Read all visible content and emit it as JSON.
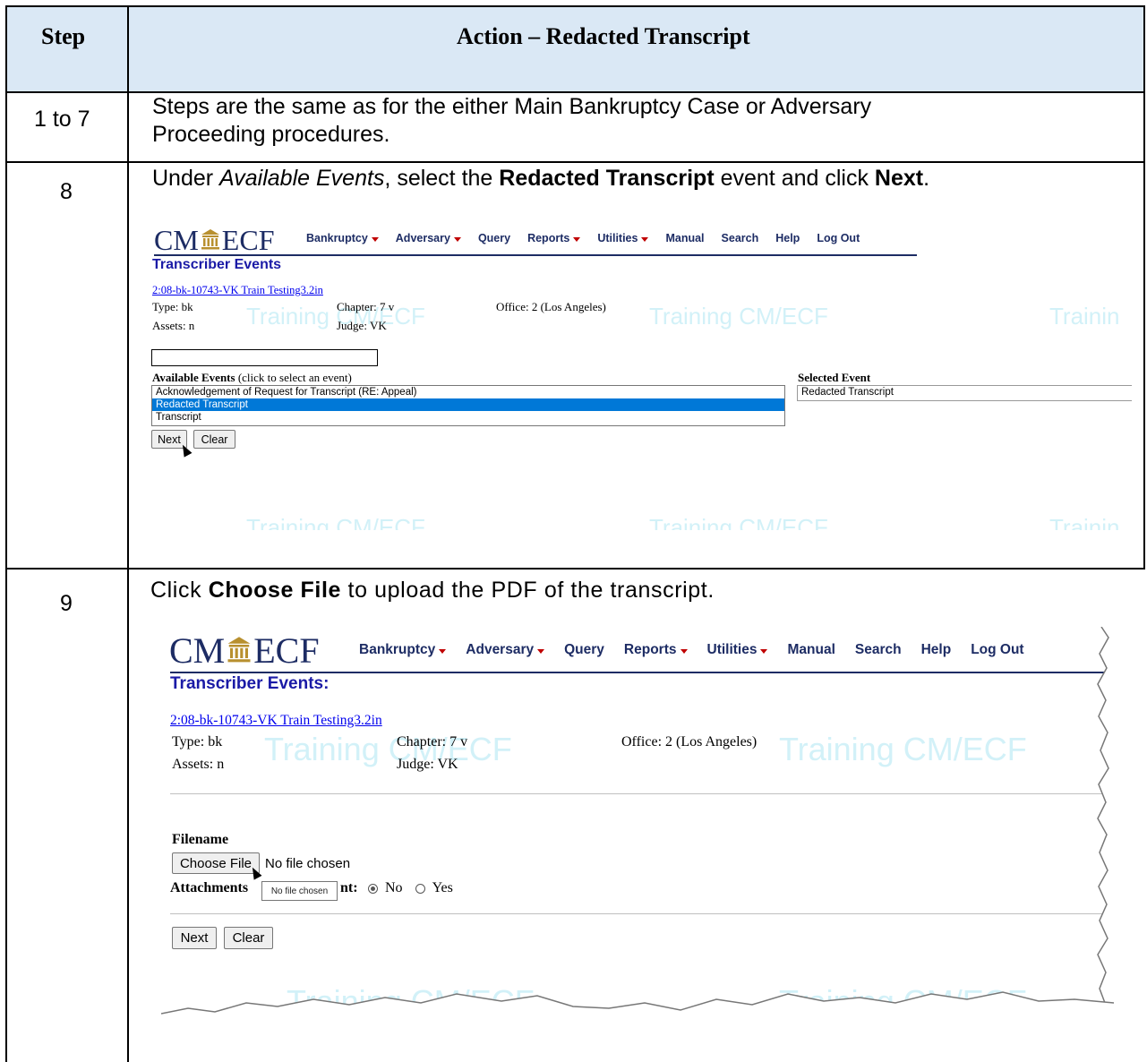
{
  "table": {
    "header": {
      "step": "Step",
      "action": "Action – Redacted Transcript"
    },
    "rows": [
      {
        "step": "1 to 7",
        "text_line1": "Steps are the same as for the either Main Bankruptcy Case or Adversary",
        "text_line2": "Proceeding procedures."
      },
      {
        "step": "8",
        "t1": "Under ",
        "t2": "Available Events",
        "t3": ", select the ",
        "t4": "Redacted Transcript",
        "t5": " event and click ",
        "t6": "Next",
        "t7": "."
      },
      {
        "step": "9",
        "t1": "Click ",
        "t2": "Choose File",
        "t3": " to upload the PDF of the transcript."
      }
    ]
  },
  "app": {
    "logo_left": "CM",
    "logo_right": "ECF",
    "menu": [
      "Bankruptcy",
      "Adversary",
      "Query",
      "Reports",
      "Utilities",
      "Manual",
      "Search",
      "Help",
      "Log Out"
    ],
    "menu_has_dropdown": [
      true,
      true,
      false,
      true,
      true,
      false,
      false,
      false,
      false
    ],
    "watermark": "Training CM/ECF",
    "watermark_cut": "Trainin",
    "accent_color": "#1d2c64",
    "title_color": "#1a1aa6",
    "caret_color": "#c00000"
  },
  "screen1": {
    "title": "Transcriber Events",
    "case_link": "2:08-bk-10743-VK Train Testing3.2in",
    "type": "Type: bk",
    "chapter": "Chapter: 7 v",
    "office": "Office: 2 (Los Angeles)",
    "assets": "Assets: n",
    "judge": "Judge: VK",
    "search_value": "",
    "available_label": "Available Events",
    "available_hint": " (click to select an event)",
    "events": [
      "Acknowledgement of Request for Transcript (RE: Appeal)",
      "Redacted Transcript",
      "Transcript"
    ],
    "selected_index": 1,
    "selected_label": "Selected Event",
    "selected_value": "Redacted Transcript",
    "next": "Next",
    "clear": "Clear"
  },
  "screen2": {
    "title": "Transcriber Events:",
    "case_link": "2:08-bk-10743-VK Train Testing3.2in",
    "type": "Type: bk",
    "chapter": "Chapter: 7 v",
    "office": "Office: 2 (Los Angeles)",
    "assets": "Assets: n",
    "judge": "Judge: VK",
    "filename_label": "Filename",
    "choose_file": "Choose File",
    "no_file": "No file chosen",
    "attachments_prefix": "Attachments",
    "attachments_suffix": "nt:",
    "tooltip": "No file chosen",
    "radio_no": "No",
    "radio_yes": "Yes",
    "radio_selected": "No",
    "next": "Next",
    "clear": "Clear"
  }
}
